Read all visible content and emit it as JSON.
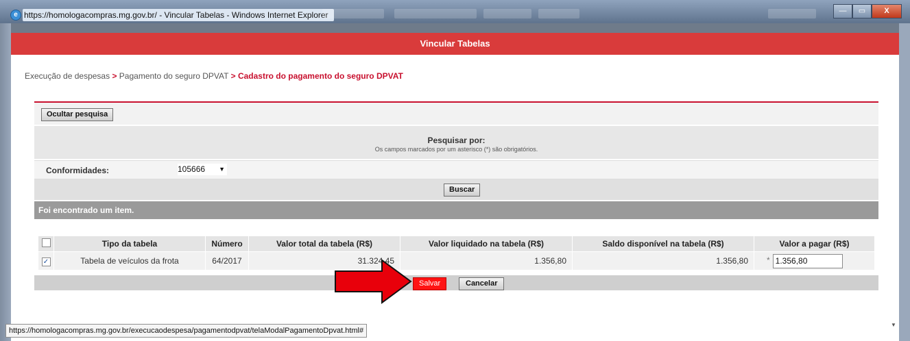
{
  "window": {
    "title": "https://homologacompras.mg.gov.br/ - Vincular Tabelas - Windows Internet Explorer",
    "minimize_glyph": "—",
    "maximize_glyph": "▭",
    "close_glyph": "X"
  },
  "header": {
    "title": "Vincular Tabelas"
  },
  "breadcrumb": {
    "items": [
      "Execução de despesas",
      "Pagamento do seguro DPVAT",
      "Cadastro do pagamento do seguro DPVAT"
    ],
    "separator": ">"
  },
  "search": {
    "toggle_label": "Ocultar pesquisa",
    "heading": "Pesquisar por:",
    "note": "Os campos marcados por um asterisco (*) são obrigatórios.",
    "conformidades_label": "Conformidades:",
    "conformidades_value": "105666",
    "submit_label": "Buscar"
  },
  "results": {
    "summary": "Foi encontrado um item.",
    "columns": [
      "Tipo da tabela",
      "Número",
      "Valor total da tabela (R$)",
      "Valor liquidado na tabela (R$)",
      "Saldo disponível na tabela (R$)",
      "Valor a pagar (R$)"
    ],
    "rows": [
      {
        "checked": true,
        "tipo": "Tabela de veículos da frota",
        "numero": "64/2017",
        "valor_total": "31.324,45",
        "valor_liquidado": "1.356,80",
        "saldo": "1.356,80",
        "required_mark": "*",
        "valor_pagar": "1.356,80"
      }
    ]
  },
  "actions": {
    "save_label": "Salvar",
    "cancel_label": "Cancelar"
  },
  "statusbar": {
    "url": "https://homologacompras.mg.gov.br/execucaodespesa/pagamentodpvat/telaModalPagamentoDpvat.html#"
  },
  "colors": {
    "header": "#d93b3b",
    "accent": "#c8102e",
    "save_button": "#ff1414",
    "arrow": "#e8000b"
  },
  "icons": {
    "app": "internet-explorer-icon",
    "checkbox_checked": "✓",
    "dropdown": "▼",
    "overlay": "red-arrow-icon"
  }
}
